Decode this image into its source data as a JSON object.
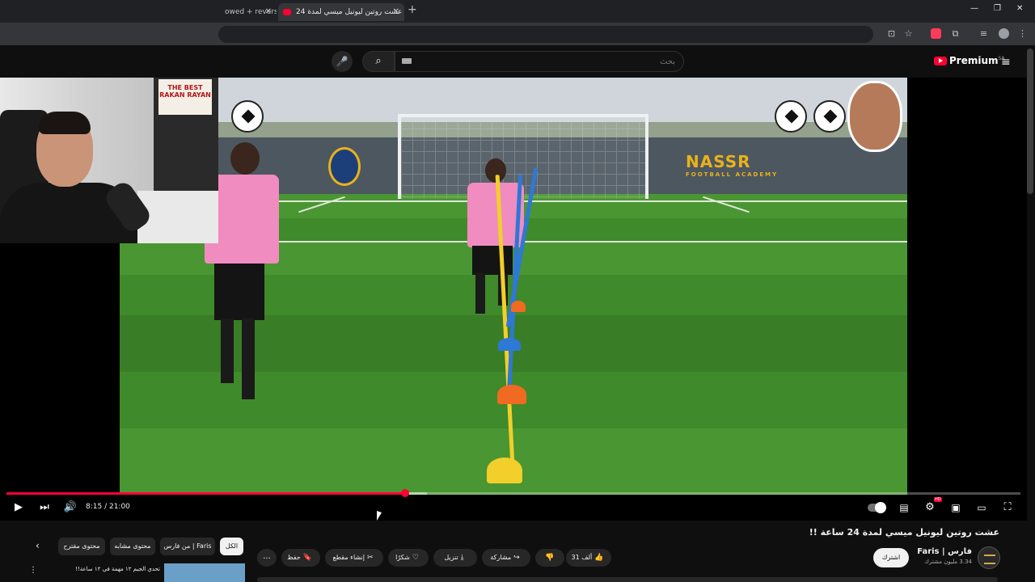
{
  "browser": {
    "tabs": [
      {
        "label": "owed + revers",
        "active": false
      },
      {
        "label": "عشت روتين ليونيل ميسي لمدة 24",
        "active": true
      }
    ],
    "new_tab": "+",
    "window_controls": {
      "minimize": "—",
      "restore": "❐",
      "close": "✕"
    }
  },
  "masthead": {
    "search_placeholder": "بحث",
    "logo_text": "Premium",
    "logo_region": "SA",
    "menu_icon": "≡"
  },
  "video": {
    "academy_text": "NASSR",
    "academy_sub": "FOOTBALL ACADEMY"
  },
  "webcam": {
    "poster_text": "THE BEST RAKAN RAYAN"
  },
  "player": {
    "time": "8:15 / 21:00",
    "progress": 0.393,
    "buffered": 0.415
  },
  "meta": {
    "title": "عشت روتين ليونيل ميسي لمدة 24 ساعة !!",
    "channel_name": "فارس | Faris",
    "subscribers": "3.34 مليون مشترك",
    "subscribe_label": "اشترك"
  },
  "actions": {
    "like_count": "31 ألف",
    "share_label": "مشاركة",
    "download_label": "تنزيل",
    "thanks_label": "شكرًا",
    "clip_label": "إنشاء مقطع",
    "save_label": "حفظ",
    "more_label": "..."
  },
  "chips": {
    "all": "الكل",
    "from_channel": "من فارس | Faris",
    "related": "محتوى مشابه",
    "recommended": "محتوى مقترح"
  },
  "recommendation": {
    "title": "تحدي الجيم ١٢ مهمة في ١٢ ساعة!!"
  }
}
